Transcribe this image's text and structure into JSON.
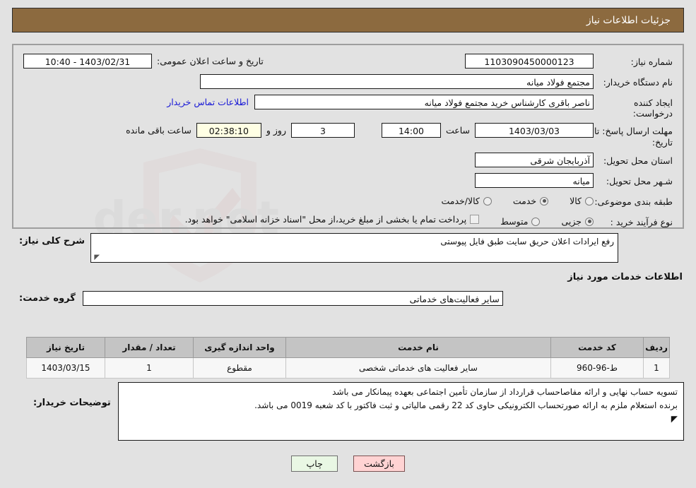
{
  "header": {
    "title": "جزئیات اطلاعات نیاز"
  },
  "form": {
    "need_number_label": "شماره نیاز:",
    "need_number_value": "1103090450000123",
    "public_announce_label": "تاریخ و ساعت اعلان عمومی:",
    "public_announce_value": "1403/02/31 - 10:40",
    "buyer_org_label": "نام دستگاه خریدار:",
    "buyer_org_value": "مجتمع فولاد میانه",
    "creator_label": "ایجاد کننده درخواست:",
    "creator_value": "ناصر باقری کارشناس خرید مجتمع فولاد میانه",
    "contact_link": "اطلاعات تماس خریدار",
    "deadline_label": "مهلت ارسال پاسخ: تا تاریخ:",
    "deadline_date": "1403/03/03",
    "hour_label": "ساعت",
    "deadline_time": "14:00",
    "remaining_days": "3",
    "days_and_label": "روز و",
    "remaining_timer": "02:38:10",
    "remaining_suffix": "ساعت باقی مانده",
    "province_label": "استان محل تحویل:",
    "province_value": "آذربایجان شرقی",
    "city_label": "شـهر محل تحویل:",
    "city_value": "میانه",
    "category_label": "طبقه بندی موضوعی:",
    "category_options": [
      {
        "label": "کالا",
        "selected": false
      },
      {
        "label": "خدمت",
        "selected": true
      },
      {
        "label": "کالا/خدمت",
        "selected": false
      }
    ],
    "process_label": "نوع فرآیند خرید :",
    "process_options": [
      {
        "label": "جزیی",
        "selected": true
      },
      {
        "label": "متوسط",
        "selected": false
      }
    ],
    "treasury_checkbox_label": "پرداخت تمام یا بخشی از مبلغ خرید،از محل \"اسناد خزانه اسلامی\" خواهد بود.",
    "treasury_checked": false
  },
  "description": {
    "label": "شرح کلی نیاز:",
    "value": "رفع ایرادات اعلان حریق سایت طبق فایل پیوستی"
  },
  "services_section": {
    "heading": "اطلاعات خدمات مورد نیاز",
    "group_label": "گروه خدمت:",
    "group_value": "سایر فعالیت‌های خدماتی"
  },
  "table": {
    "columns": [
      "ردیف",
      "کد خدمت",
      "نام خدمت",
      "واحد اندازه گیری",
      "تعداد / مقدار",
      "تاریخ نیاز"
    ],
    "rows": [
      {
        "index": "1",
        "service_code": "ط-96-960",
        "service_name": "سایر فعالیت های خدماتی شخصی",
        "unit": "مقطوع",
        "quantity": "1",
        "need_date": "1403/03/15"
      }
    ]
  },
  "buyer_notes": {
    "label": "توضیحات خریدار:",
    "line1": "تسویه حساب نهایی و ارائه مفاصاحساب قرارداد از سازمان تأمین اجتماعی بعهده پیمانکار می باشد",
    "line2": "برنده استعلام ملزم به ارائه صورتحساب الکترونیکی حاوی کد 22 رقمی مالیاتی و  ثبت فاکتور با کد شعبه 0019  می باشد."
  },
  "footer": {
    "back_label": "بازگشت",
    "print_label": "چاپ"
  },
  "watermark": {
    "text": "AnaTender.net"
  },
  "colors": {
    "header_bg": "#8c6a3f",
    "page_bg": "#e2e2e2",
    "link": "#1919d6",
    "back_btn": "#ffd3d3",
    "print_btn": "#e9f7e4",
    "timer_bg": "#ffffe4"
  }
}
